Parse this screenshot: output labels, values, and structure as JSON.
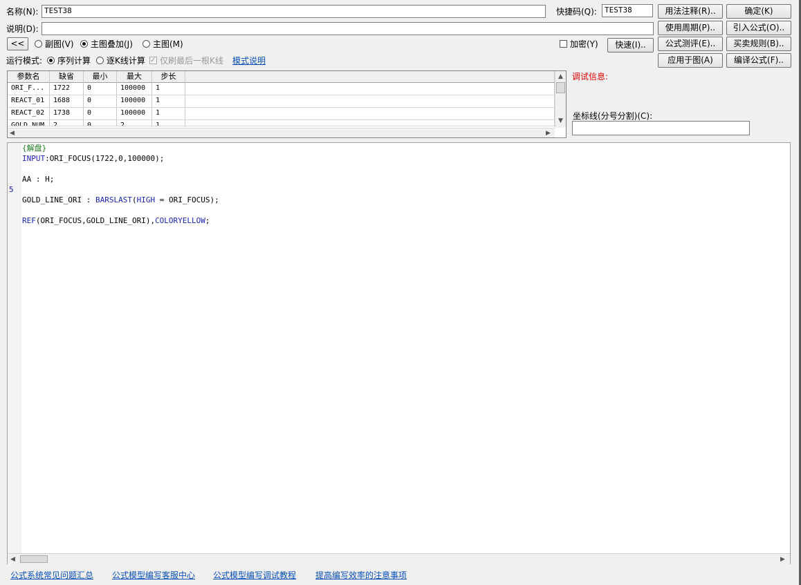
{
  "header": {
    "name_label": "名称(N):",
    "name_value": "TEST38",
    "hotkey_label": "快捷码(Q):",
    "hotkey_value": "TEST38",
    "desc_label": "说明(D):",
    "desc_value": ""
  },
  "buttons": {
    "usage_notes": "用法注释(R)..",
    "ok": "确定(K)",
    "use_period": "使用周期(P)..",
    "import_formula": "引入公式(O)..",
    "formula_test": "公式测评(E)..",
    "trade_rules": "买卖规则(B)..",
    "apply_chart": "应用于图(A)",
    "compile": "编译公式(F)..",
    "quick": "快速(I)..",
    "collapse": "<<"
  },
  "display_mode": {
    "options": [
      "副图(V)",
      "主图叠加(J)",
      "主图(M)"
    ],
    "selected": "主图叠加(J)"
  },
  "encrypt_label": "加密(Y)",
  "run_mode": {
    "label": "运行模式:",
    "options": [
      "序列计算",
      "逐K线计算"
    ],
    "selected": "序列计算",
    "refresh_last_label": "仅刷最后一根K线",
    "mode_help_link": "模式说明"
  },
  "params": {
    "columns": [
      "参数名",
      "缺省",
      "最小",
      "最大",
      "步长"
    ],
    "rows": [
      [
        "ORI_F...",
        "1722",
        "0",
        "100000",
        "1"
      ],
      [
        "REACT_01",
        "1688",
        "0",
        "100000",
        "1"
      ],
      [
        "REACT_02",
        "1738",
        "0",
        "100000",
        "1"
      ],
      [
        "GOLD_NUM",
        "2",
        "0",
        "2",
        "1"
      ]
    ]
  },
  "debug_info_label": "调试信息:",
  "axis_label": "坐标线(分号分割)(C):",
  "axis_value": "",
  "editor": {
    "line_marker": "5",
    "lines": [
      {
        "comment": "{解盘}"
      },
      {
        "kw": "INPUT",
        "rest": ":ORI_FOCUS(1722,0,100000);"
      },
      {
        "plain": ""
      },
      {
        "plain": "AA : H;"
      },
      {
        "plain": ""
      },
      {
        "pre": "GOLD_LINE_ORI : ",
        "fn": "BARSLAST",
        "mid": "(",
        "kw2": "HIGH",
        "rest": " = ORI_FOCUS);"
      },
      {
        "plain": ""
      },
      {
        "fn": "REF",
        "mid": "(ORI_FOCUS,GOLD_LINE_ORI),",
        "kw2": "COLORYELLOW",
        "rest": ";"
      }
    ]
  },
  "footer_links": [
    "公式系统常见问题汇总",
    "公式模型编写客服中心",
    "公式模型编写调试教程",
    "提高编写效率的注意事项"
  ],
  "colors": {
    "debug_label": "#e00000",
    "link": "#0a4fb8",
    "keyword": "#1b22b0",
    "comment": "#1e7a1e"
  }
}
